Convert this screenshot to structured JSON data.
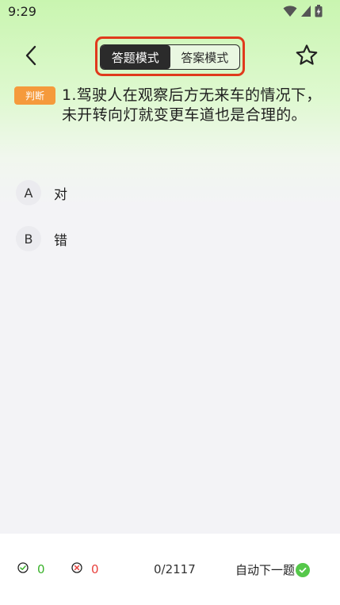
{
  "status_bar": {
    "time": "9:29",
    "icons": [
      "wifi-icon",
      "signal-icon",
      "battery-icon"
    ]
  },
  "header": {
    "modes": [
      {
        "label": "答题模式",
        "active": true
      },
      {
        "label": "答案模式",
        "active": false
      }
    ],
    "icons": [
      "back-icon",
      "star-icon"
    ],
    "highlight_color": "#e03a1c"
  },
  "question": {
    "type_badge": "判断",
    "text": "1.驾驶人在观察后方无来车的情况下，未开转向灯就变更车道也是合理的。"
  },
  "options": [
    {
      "letter": "A",
      "text": "对"
    },
    {
      "letter": "B",
      "text": "错"
    }
  ],
  "bottom_bar": {
    "correct_count": "0",
    "wrong_count": "0",
    "progress": "0/2117",
    "auto_next_label": "自动下一题",
    "auto_next_enabled": true
  },
  "colors": {
    "badge": "#f59a3c",
    "correct": "#39b22a",
    "wrong": "#e8413d",
    "toggle_active": "#2b2b2b",
    "auto_next_check": "#55c84a"
  }
}
